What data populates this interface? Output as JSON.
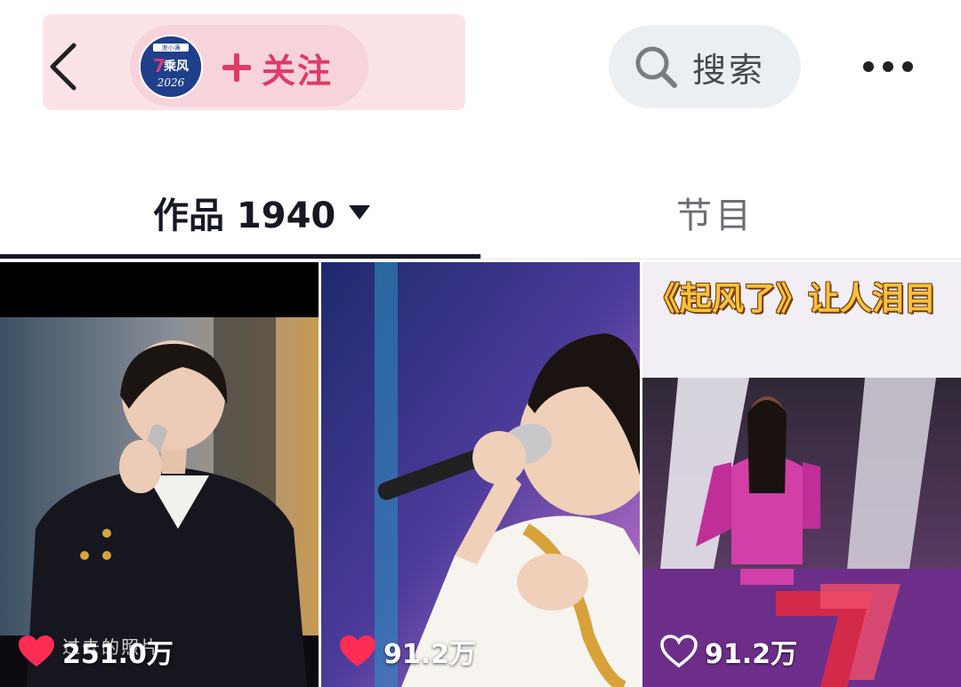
{
  "header": {
    "account_logo_lines": [
      "浪小满",
      "乘风",
      "2026"
    ],
    "follow_label": "关注",
    "search_label": "搜索",
    "colors": {
      "accent": "#e03a66",
      "panel": "#fbe3e8"
    }
  },
  "tabs": [
    {
      "label": "作品 1940",
      "active": true
    },
    {
      "label": "节目",
      "active": false
    }
  ],
  "videos": [
    {
      "likes": "251.0万",
      "liked": true,
      "caption": "过去的照片"
    },
    {
      "likes": "91.2万",
      "liked": true
    },
    {
      "likes": "91.2万",
      "liked": false,
      "cover_title": "《起风了》让人泪目"
    }
  ],
  "icons": [
    "back-arrow-icon",
    "plus-icon",
    "search-icon",
    "more-dots-icon",
    "dropdown-triangle-icon",
    "heart-icon"
  ]
}
